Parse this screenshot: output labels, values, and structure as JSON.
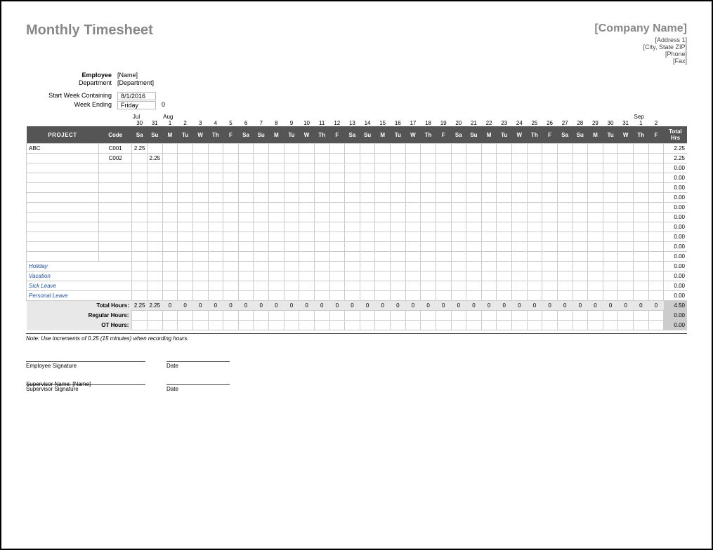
{
  "title": "Monthly Timesheet",
  "company": {
    "name": "[Company Name]",
    "address1": "[Address 1]",
    "address2": "[City, State ZIP]",
    "phone": "[Phone]",
    "fax": "[Fax]"
  },
  "meta": {
    "employee_label": "Employee",
    "employee_value": "[Name]",
    "department_label": "Department",
    "department_value": "[Department]",
    "start_week_label": "Start Week Containing",
    "start_week_value": "8/1/2016",
    "week_ending_label": "Week Ending",
    "week_ending_value": "Friday",
    "week_ending_num": "0"
  },
  "columns": {
    "project": "PROJECT",
    "code": "Code",
    "total": "Total Hrs"
  },
  "months": {
    "jul": "Jul",
    "aug": "Aug",
    "sep": "Sep",
    "jul_start_idx": 0,
    "aug_start_idx": 2,
    "sep_start_idx": 33
  },
  "date_numbers": [
    "30",
    "31",
    "1",
    "2",
    "3",
    "4",
    "5",
    "6",
    "7",
    "8",
    "9",
    "10",
    "11",
    "12",
    "13",
    "14",
    "15",
    "16",
    "17",
    "18",
    "19",
    "20",
    "21",
    "22",
    "23",
    "24",
    "25",
    "26",
    "27",
    "28",
    "29",
    "30",
    "31",
    "1",
    "2"
  ],
  "day_labels": [
    "Sa",
    "Su",
    "M",
    "Tu",
    "W",
    "Th",
    "F",
    "Sa",
    "Su",
    "M",
    "Tu",
    "W",
    "Th",
    "F",
    "Sa",
    "Su",
    "M",
    "Tu",
    "W",
    "Th",
    "F",
    "Sa",
    "Su",
    "M",
    "Tu",
    "W",
    "Th",
    "F",
    "Sa",
    "Su",
    "M",
    "Tu",
    "W",
    "Th",
    "F"
  ],
  "rows": [
    {
      "project": "ABC",
      "code": "C001",
      "cells": [
        "2.25",
        "",
        "",
        "",
        "",
        "",
        "",
        "",
        "",
        "",
        "",
        "",
        "",
        "",
        "",
        "",
        "",
        "",
        "",
        "",
        "",
        "",
        "",
        "",
        "",
        "",
        "",
        "",
        "",
        "",
        "",
        "",
        "",
        "",
        ""
      ],
      "total": "2.25"
    },
    {
      "project": "",
      "code": "C002",
      "cells": [
        "",
        "2.25",
        "",
        "",
        "",
        "",
        "",
        "",
        "",
        "",
        "",
        "",
        "",
        "",
        "",
        "",
        "",
        "",
        "",
        "",
        "",
        "",
        "",
        "",
        "",
        "",
        "",
        "",
        "",
        "",
        "",
        "",
        "",
        "",
        ""
      ],
      "total": "2.25"
    },
    {
      "project": "",
      "code": "",
      "cells": [
        "",
        "",
        "",
        "",
        "",
        "",
        "",
        "",
        "",
        "",
        "",
        "",
        "",
        "",
        "",
        "",
        "",
        "",
        "",
        "",
        "",
        "",
        "",
        "",
        "",
        "",
        "",
        "",
        "",
        "",
        "",
        "",
        "",
        "",
        ""
      ],
      "total": "0.00"
    },
    {
      "project": "",
      "code": "",
      "cells": [
        "",
        "",
        "",
        "",
        "",
        "",
        "",
        "",
        "",
        "",
        "",
        "",
        "",
        "",
        "",
        "",
        "",
        "",
        "",
        "",
        "",
        "",
        "",
        "",
        "",
        "",
        "",
        "",
        "",
        "",
        "",
        "",
        "",
        "",
        ""
      ],
      "total": "0.00"
    },
    {
      "project": "",
      "code": "",
      "cells": [
        "",
        "",
        "",
        "",
        "",
        "",
        "",
        "",
        "",
        "",
        "",
        "",
        "",
        "",
        "",
        "",
        "",
        "",
        "",
        "",
        "",
        "",
        "",
        "",
        "",
        "",
        "",
        "",
        "",
        "",
        "",
        "",
        "",
        "",
        ""
      ],
      "total": "0.00"
    },
    {
      "project": "",
      "code": "",
      "cells": [
        "",
        "",
        "",
        "",
        "",
        "",
        "",
        "",
        "",
        "",
        "",
        "",
        "",
        "",
        "",
        "",
        "",
        "",
        "",
        "",
        "",
        "",
        "",
        "",
        "",
        "",
        "",
        "",
        "",
        "",
        "",
        "",
        "",
        "",
        ""
      ],
      "total": "0.00"
    },
    {
      "project": "",
      "code": "",
      "cells": [
        "",
        "",
        "",
        "",
        "",
        "",
        "",
        "",
        "",
        "",
        "",
        "",
        "",
        "",
        "",
        "",
        "",
        "",
        "",
        "",
        "",
        "",
        "",
        "",
        "",
        "",
        "",
        "",
        "",
        "",
        "",
        "",
        "",
        "",
        ""
      ],
      "total": "0.00"
    },
    {
      "project": "",
      "code": "",
      "cells": [
        "",
        "",
        "",
        "",
        "",
        "",
        "",
        "",
        "",
        "",
        "",
        "",
        "",
        "",
        "",
        "",
        "",
        "",
        "",
        "",
        "",
        "",
        "",
        "",
        "",
        "",
        "",
        "",
        "",
        "",
        "",
        "",
        "",
        "",
        ""
      ],
      "total": "0.00"
    },
    {
      "project": "",
      "code": "",
      "cells": [
        "",
        "",
        "",
        "",
        "",
        "",
        "",
        "",
        "",
        "",
        "",
        "",
        "",
        "",
        "",
        "",
        "",
        "",
        "",
        "",
        "",
        "",
        "",
        "",
        "",
        "",
        "",
        "",
        "",
        "",
        "",
        "",
        "",
        "",
        ""
      ],
      "total": "0.00"
    },
    {
      "project": "",
      "code": "",
      "cells": [
        "",
        "",
        "",
        "",
        "",
        "",
        "",
        "",
        "",
        "",
        "",
        "",
        "",
        "",
        "",
        "",
        "",
        "",
        "",
        "",
        "",
        "",
        "",
        "",
        "",
        "",
        "",
        "",
        "",
        "",
        "",
        "",
        "",
        "",
        ""
      ],
      "total": "0.00"
    },
    {
      "project": "",
      "code": "",
      "cells": [
        "",
        "",
        "",
        "",
        "",
        "",
        "",
        "",
        "",
        "",
        "",
        "",
        "",
        "",
        "",
        "",
        "",
        "",
        "",
        "",
        "",
        "",
        "",
        "",
        "",
        "",
        "",
        "",
        "",
        "",
        "",
        "",
        "",
        "",
        ""
      ],
      "total": "0.00"
    },
    {
      "project": "",
      "code": "",
      "cells": [
        "",
        "",
        "",
        "",
        "",
        "",
        "",
        "",
        "",
        "",
        "",
        "",
        "",
        "",
        "",
        "",
        "",
        "",
        "",
        "",
        "",
        "",
        "",
        "",
        "",
        "",
        "",
        "",
        "",
        "",
        "",
        "",
        "",
        "",
        ""
      ],
      "total": "0.00"
    }
  ],
  "leave_rows": [
    {
      "project": "Holiday",
      "cells": [
        "",
        "",
        "",
        "",
        "",
        "",
        "",
        "",
        "",
        "",
        "",
        "",
        "",
        "",
        "",
        "",
        "",
        "",
        "",
        "",
        "",
        "",
        "",
        "",
        "",
        "",
        "",
        "",
        "",
        "",
        "",
        "",
        "",
        "",
        ""
      ],
      "total": "0.00"
    },
    {
      "project": "Vacation",
      "cells": [
        "",
        "",
        "",
        "",
        "",
        "",
        "",
        "",
        "",
        "",
        "",
        "",
        "",
        "",
        "",
        "",
        "",
        "",
        "",
        "",
        "",
        "",
        "",
        "",
        "",
        "",
        "",
        "",
        "",
        "",
        "",
        "",
        "",
        "",
        ""
      ],
      "total": "0.00"
    },
    {
      "project": "Sick Leave",
      "cells": [
        "",
        "",
        "",
        "",
        "",
        "",
        "",
        "",
        "",
        "",
        "",
        "",
        "",
        "",
        "",
        "",
        "",
        "",
        "",
        "",
        "",
        "",
        "",
        "",
        "",
        "",
        "",
        "",
        "",
        "",
        "",
        "",
        "",
        "",
        ""
      ],
      "total": "0.00"
    },
    {
      "project": "Personal Leave",
      "cells": [
        "",
        "",
        "",
        "",
        "",
        "",
        "",
        "",
        "",
        "",
        "",
        "",
        "",
        "",
        "",
        "",
        "",
        "",
        "",
        "",
        "",
        "",
        "",
        "",
        "",
        "",
        "",
        "",
        "",
        "",
        "",
        "",
        "",
        "",
        ""
      ],
      "total": "0.00"
    }
  ],
  "totals": {
    "total_hours_label": "Total Hours:",
    "total_hours_cells": [
      "2.25",
      "2.25",
      "0",
      "0",
      "0",
      "0",
      "0",
      "0",
      "0",
      "0",
      "0",
      "0",
      "0",
      "0",
      "0",
      "0",
      "0",
      "0",
      "0",
      "0",
      "0",
      "0",
      "0",
      "0",
      "0",
      "0",
      "0",
      "0",
      "0",
      "0",
      "0",
      "0",
      "0",
      "0",
      "0"
    ],
    "total_hours_total": "4.50",
    "regular_label": "Regular Hours:",
    "regular_total": "0.00",
    "ot_label": "OT Hours:",
    "ot_total": "0.00"
  },
  "note": "Note: Use increments of 0.25 (15 minutes) when recording hours.",
  "signatures": {
    "employee_sig": "Employee Signature",
    "date": "Date",
    "supervisor_sig": "Supervisor Signature",
    "supervisor_name_label": "Supervisor Name:",
    "supervisor_name_value": "[Name]"
  }
}
